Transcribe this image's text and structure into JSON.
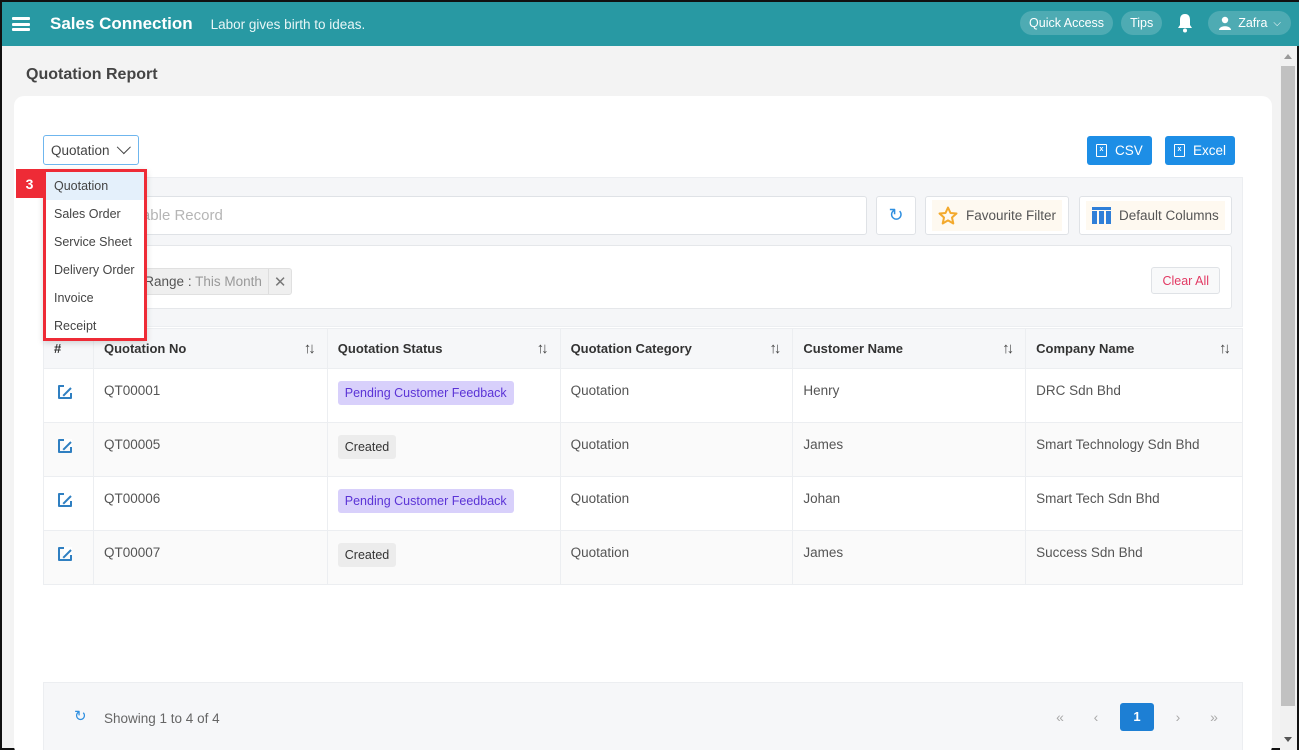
{
  "topbar": {
    "app_title": "Sales Connection",
    "tagline": "Labor gives birth to ideas.",
    "quick_access": "Quick Access",
    "tips": "Tips",
    "user_name": "Zafra",
    "brand_color": "#2899a3"
  },
  "page": {
    "title": "Quotation Report"
  },
  "report_type": {
    "selected": "Quotation",
    "options": [
      "Quotation",
      "Sales Order",
      "Service Sheet",
      "Delivery Order",
      "Invoice",
      "Receipt"
    ],
    "step_marker": "3"
  },
  "export": {
    "csv_label": "CSV",
    "excel_label": "Excel"
  },
  "filters": {
    "search_placeholder": "Search Table Record",
    "favourite_filter": "Favourite Filter",
    "default_columns": "Default Columns",
    "active_tag_label": "Date Range",
    "active_tag_separator": ":",
    "active_tag_value": "This Month",
    "clear_all": "Clear All"
  },
  "table": {
    "columns": [
      "#",
      "Quotation No",
      "Quotation Status",
      "Quotation Category",
      "Customer Name",
      "Company Name"
    ],
    "rows": [
      {
        "quotation_no": "QT00001",
        "status": "Pending Customer Feedback",
        "status_type": "pending",
        "category": "Quotation",
        "customer": "Henry",
        "company": "DRC Sdn Bhd"
      },
      {
        "quotation_no": "QT00005",
        "status": "Created",
        "status_type": "created",
        "category": "Quotation",
        "customer": "James",
        "company": "Smart Technology Sdn Bhd"
      },
      {
        "quotation_no": "QT00006",
        "status": "Pending Customer Feedback",
        "status_type": "pending",
        "category": "Quotation",
        "customer": "Johan",
        "company": "Smart Tech Sdn Bhd"
      },
      {
        "quotation_no": "QT00007",
        "status": "Created",
        "status_type": "created",
        "category": "Quotation",
        "customer": "James",
        "company": "Success Sdn Bhd"
      }
    ]
  },
  "footer": {
    "showing": "Showing 1 to 4 of 4",
    "first": "«",
    "prev": "‹",
    "current_page": "1",
    "next": "›",
    "last": "»"
  }
}
